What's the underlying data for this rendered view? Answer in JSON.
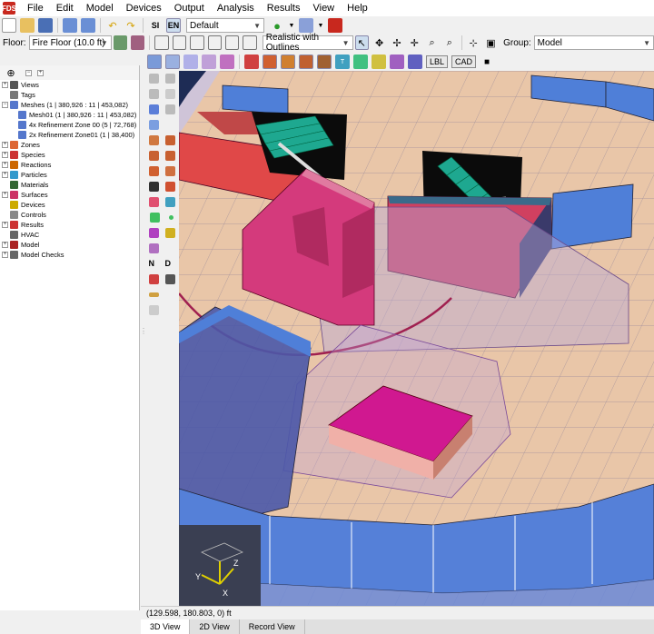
{
  "app": {
    "logo": "FDS"
  },
  "menu": [
    "File",
    "Edit",
    "Model",
    "Devices",
    "Output",
    "Analysis",
    "Results",
    "View",
    "Help"
  ],
  "toolbar1": {
    "si": "SI",
    "en": "EN",
    "scene": "Default"
  },
  "toolbar2": {
    "floor_label": "Floor:",
    "floor_value": "Fire Floor (10.0 ft)",
    "render_mode": "Realistic with Outlines",
    "group_label": "Group:",
    "group_value": "Model"
  },
  "toolbar3": {
    "lbl": "LBL",
    "cad": "CAD"
  },
  "tree": [
    {
      "label": "Views",
      "indent": 0,
      "exp": "+",
      "color": "#555"
    },
    {
      "label": "Tags",
      "indent": 0,
      "exp": "",
      "color": "#777"
    },
    {
      "label": "Meshes (1 | 380,926 : 11 | 453,082)",
      "indent": 0,
      "exp": "−",
      "color": "#5577cc"
    },
    {
      "label": "Mesh01 (1 | 380,926 : 11 | 453,082)",
      "indent": 1,
      "exp": "",
      "color": "#5577cc"
    },
    {
      "label": "4x Refinement Zone 00 (5 | 72,768)",
      "indent": 1,
      "exp": "",
      "color": "#5577cc"
    },
    {
      "label": "2x Refinement Zone01 (1 | 38,400)",
      "indent": 1,
      "exp": "",
      "color": "#5577cc"
    },
    {
      "label": "Zones",
      "indent": 0,
      "exp": "+",
      "color": "#dd6633"
    },
    {
      "label": "Species",
      "indent": 0,
      "exp": "+",
      "color": "#cc3333"
    },
    {
      "label": "Reactions",
      "indent": 0,
      "exp": "+",
      "color": "#cc6600"
    },
    {
      "label": "Particles",
      "indent": 0,
      "exp": "+",
      "color": "#3399cc"
    },
    {
      "label": "Materials",
      "indent": 0,
      "exp": "",
      "color": "#336633"
    },
    {
      "label": "Surfaces",
      "indent": 0,
      "exp": "+",
      "color": "#cc3366"
    },
    {
      "label": "Devices",
      "indent": 0,
      "exp": "",
      "color": "#ccaa00"
    },
    {
      "label": "Controls",
      "indent": 0,
      "exp": "",
      "color": "#888888"
    },
    {
      "label": "Results",
      "indent": 0,
      "exp": "+",
      "color": "#cc3333"
    },
    {
      "label": "HVAC",
      "indent": 0,
      "exp": "",
      "color": "#666666"
    },
    {
      "label": "Model",
      "indent": 0,
      "exp": "+",
      "color": "#aa2222"
    },
    {
      "label": "Model Checks",
      "indent": 0,
      "exp": "+",
      "color": "#666666"
    }
  ],
  "status": {
    "coords": "(129.598, 180.803, 0) ft"
  },
  "tabs": [
    "3D View",
    "2D View",
    "Record View"
  ],
  "axes": {
    "x": "X",
    "y": "Y",
    "z": "Z"
  }
}
